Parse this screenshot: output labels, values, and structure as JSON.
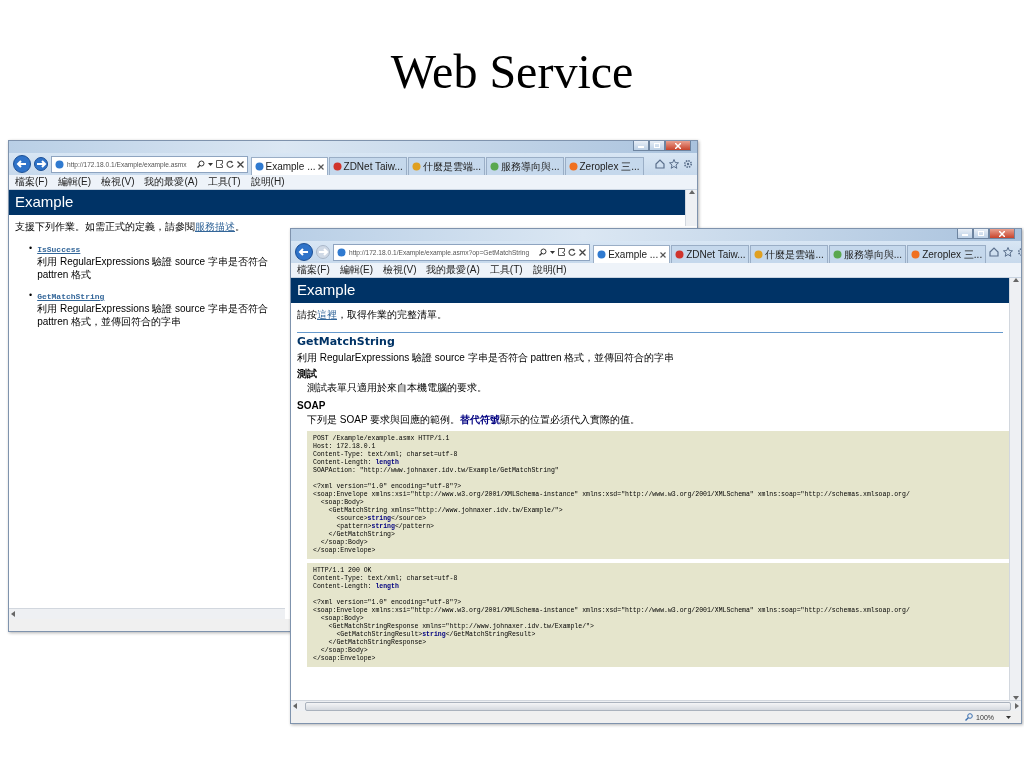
{
  "slide_title": "Web Service",
  "windows": [
    {
      "address": "http://172.18.0.1/Example/example.asmx",
      "back_enabled": true,
      "forward_enabled": true,
      "tabs": [
        {
          "label": "Example ...",
          "selected": true,
          "color": "#2f7ad0"
        },
        {
          "label": "ZDNet Taiw...",
          "selected": false,
          "color": "#d0342c"
        },
        {
          "label": "什麼是雲端...",
          "selected": false,
          "color": "#e0a020"
        },
        {
          "label": "服務導向與...",
          "selected": false,
          "color": "#5aa84f"
        },
        {
          "label": "Zeroplex 三...",
          "selected": false,
          "color": "#f07020"
        }
      ],
      "menu": [
        "檔案(F)",
        "編輯(E)",
        "檢視(V)",
        "我的最愛(A)",
        "工具(T)",
        "說明(H)"
      ],
      "page": {
        "kind": "list",
        "banner": "Example",
        "intro": {
          "before": "支援下列作業。如需正式的定義，請參閱",
          "link": "服務描述",
          "after": "。"
        },
        "operations": [
          {
            "bullet": "•",
            "name": "IsSuccess",
            "description": "利用 RegularExpressions 驗證 source 字串是否符合 pattren 格式"
          },
          {
            "bullet": "•",
            "name": "GetMatchString",
            "description": "利用 RegularExpressions 驗證 source 字串是否符合 pattren 格式，並傳回符合的字串"
          }
        ]
      }
    },
    {
      "address": "http://172.18.0.1/Example/example.asmx?op=GetMatchString",
      "back_enabled": true,
      "forward_enabled": false,
      "tabs": [
        {
          "label": "Example ...",
          "selected": true,
          "color": "#2f7ad0"
        },
        {
          "label": "ZDNet Taiw...",
          "selected": false,
          "color": "#d0342c"
        },
        {
          "label": "什麼是雲端...",
          "selected": false,
          "color": "#e0a020"
        },
        {
          "label": "服務導向與...",
          "selected": false,
          "color": "#5aa84f"
        },
        {
          "label": "Zeroplex 三...",
          "selected": false,
          "color": "#f07020"
        }
      ],
      "menu": [
        "檔案(F)",
        "編輯(E)",
        "檢視(V)",
        "我的最愛(A)",
        "工具(T)",
        "說明(H)"
      ],
      "page": {
        "kind": "operation",
        "banner": "Example",
        "intro": {
          "before": "請按",
          "link": "這裡",
          "after": "，取得作業的完整清單。"
        },
        "operation": {
          "name": "GetMatchString",
          "description": "利用 RegularExpressions 驗證 source 字串是否符合 pattren 格式，並傳回符合的字串"
        },
        "sections": [
          {
            "heading": "測試",
            "text": "測試表單只適用於來自本機電腦的要求。"
          },
          {
            "heading": "SOAP",
            "text": "下列是 SOAP 要求與回應的範例。**替代符號**顯示的位置必須代入實際的值。",
            "code_blocks": [
              {
                "sections": [
                  [
                    "POST /Example/example.asmx HTTP/1.1",
                    "Host: 172.18.0.1",
                    "Content-Type: text/xml; charset=utf-8",
                    "Content-Length: **length**",
                    "SOAPAction: \"http://www.johnaxer.idv.tw/Example/GetMatchString\""
                  ],
                  [
                    "<?xml version=\"1.0\" encoding=\"utf-8\"?>",
                    "<soap:Envelope xmlns:xsi=\"http://www.w3.org/2001/XMLSchema-instance\" xmlns:xsd=\"http://www.w3.org/2001/XMLSchema\" xmlns:soap=\"http://schemas.xmlsoap.org/",
                    "  <soap:Body>",
                    "    <GetMatchString xmlns=\"http://www.johnaxer.idv.tw/Example/\">",
                    "      <source>**string**</source>",
                    "      <pattern>**string**</pattern>",
                    "    </GetMatchString>",
                    "  </soap:Body>",
                    "</soap:Envelope>"
                  ]
                ]
              },
              {
                "sections": [
                  [
                    "HTTP/1.1 200 OK",
                    "Content-Type: text/xml; charset=utf-8",
                    "Content-Length: **length**"
                  ],
                  [
                    "<?xml version=\"1.0\" encoding=\"utf-8\"?>",
                    "<soap:Envelope xmlns:xsi=\"http://www.w3.org/2001/XMLSchema-instance\" xmlns:xsd=\"http://www.w3.org/2001/XMLSchema\" xmlns:soap=\"http://schemas.xmlsoap.org/",
                    "  <soap:Body>",
                    "    <GetMatchStringResponse xmlns=\"http://www.johnaxer.idv.tw/Example/\">",
                    "      <GetMatchStringResult>**string**</GetMatchStringResult>",
                    "    </GetMatchStringResponse>",
                    "  </soap:Body>",
                    "</soap:Envelope>"
                  ]
                ]
              }
            ]
          }
        ]
      },
      "status": {
        "zoom": "100%"
      }
    }
  ]
}
